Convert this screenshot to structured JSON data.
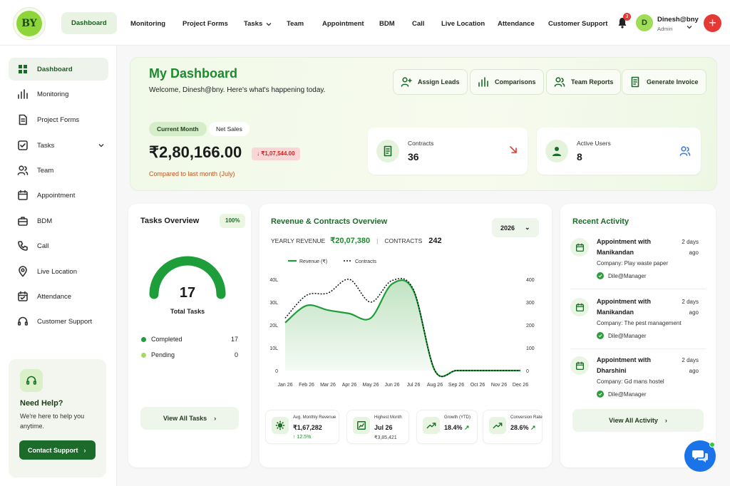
{
  "brand": {
    "logo_text": "BY"
  },
  "topnav": {
    "items": [
      {
        "label": "Dashboard"
      },
      {
        "label": "Monitoring"
      },
      {
        "label": "Project Forms"
      },
      {
        "label": "Tasks"
      },
      {
        "label": "Team"
      },
      {
        "label": "Appointment"
      },
      {
        "label": "BDM"
      },
      {
        "label": "Call"
      },
      {
        "label": "Live Location"
      },
      {
        "label": "Attendance"
      },
      {
        "label": "Customer Support"
      }
    ],
    "notification_count": "3",
    "user": {
      "initial": "D",
      "name": "Dinesh@bny",
      "role": "Admin"
    },
    "add_label": "+"
  },
  "sidebar": {
    "items": [
      {
        "label": "Dashboard",
        "icon": "grid-icon"
      },
      {
        "label": "Monitoring",
        "icon": "bar-chart-icon"
      },
      {
        "label": "Project Forms",
        "icon": "document-icon"
      },
      {
        "label": "Tasks",
        "icon": "checkbox-icon"
      },
      {
        "label": "Team",
        "icon": "users-icon"
      },
      {
        "label": "Appointment",
        "icon": "calendar-icon"
      },
      {
        "label": "BDM",
        "icon": "briefcase-icon"
      },
      {
        "label": "Call",
        "icon": "phone-icon"
      },
      {
        "label": "Live Location",
        "icon": "location-pin-icon"
      },
      {
        "label": "Attendance",
        "icon": "calendar-check-icon"
      },
      {
        "label": "Customer Support",
        "icon": "headset-icon"
      }
    ],
    "help": {
      "title": "Need Help?",
      "text": "We're here to help you anytime.",
      "button": "Contact Support"
    }
  },
  "hero": {
    "title": "My Dashboard",
    "subtitle": "Welcome, Dinesh@bny. Here's what's happening today.",
    "actions": [
      {
        "label": "Assign Leads",
        "icon": "user-plus-icon"
      },
      {
        "label": "Comparisons",
        "icon": "bar-chart-icon"
      },
      {
        "label": "Team Reports",
        "icon": "users-icon"
      },
      {
        "label": "Generate Invoice",
        "icon": "invoice-icon"
      }
    ],
    "tabs": [
      "Current Month",
      "Net Sales"
    ],
    "amount": "₹2,80,166.00",
    "delta": "↓ ₹1,07,544.00",
    "compare_text": "Compared to last month (July)",
    "kpis": [
      {
        "label": "Contracts",
        "value": "36",
        "trend": "down"
      },
      {
        "label": "Active Users",
        "value": "8"
      }
    ]
  },
  "tasks": {
    "title": "Tasks Overview",
    "percent": "100%",
    "progress": 1.0,
    "total": "17",
    "total_label": "Total Tasks",
    "legend": [
      {
        "label": "Completed",
        "value": "17",
        "color": "#1e9e3a"
      },
      {
        "label": "Pending",
        "value": "0",
        "color": "#a5d95f"
      }
    ],
    "button": "View All Tasks"
  },
  "revenue": {
    "title": "Revenue & Contracts Overview",
    "year": "2026",
    "yearly_label": "YEARLY REVENUE",
    "yearly_value": "₹20,07,380",
    "contracts_label": "CONTRACTS",
    "contracts_value": "242",
    "stats": [
      {
        "label": "Avg. Monthly Revenue",
        "value": "₹1,67,282",
        "sub": "↑ 12.5%",
        "icon": "gear-icon"
      },
      {
        "label": "Highest Month",
        "value": "Jul 26",
        "sub": "₹3,85,421",
        "icon": "chart-box-icon"
      },
      {
        "label": "Growth (YTD)",
        "value": "18.4%",
        "sub": "",
        "icon": "trend-up-icon"
      },
      {
        "label": "Conversion Rate",
        "value": "28.6%",
        "sub": "",
        "icon": "trend-up-icon"
      }
    ]
  },
  "chart_data": {
    "type": "line",
    "categories": [
      "Jan 26",
      "Feb 26",
      "Mar 26",
      "Apr 26",
      "May 26",
      "Jun 26",
      "Jul 26",
      "Aug 26",
      "Sep 26",
      "Oct 26",
      "Nov 26",
      "Dec 26"
    ],
    "series": [
      {
        "name": "Revenue (₹)",
        "axis": "left",
        "style": "area",
        "color": "#1e9e3a",
        "values": [
          21000,
          28500,
          26500,
          25000,
          23000,
          38000,
          35000,
          0,
          0,
          0,
          0,
          0
        ]
      },
      {
        "name": "Contracts",
        "axis": "right",
        "style": "dotted",
        "color": "#111111",
        "values": [
          230,
          330,
          340,
          400,
          300,
          395,
          355,
          0,
          0,
          0,
          0,
          0
        ]
      }
    ],
    "y_left": {
      "ticks": [
        "40L",
        "30L",
        "20L",
        "10L",
        "0"
      ],
      "lim": [
        0,
        40000
      ]
    },
    "y_right": {
      "ticks": [
        "400",
        "300",
        "200",
        "100",
        "0"
      ],
      "lim": [
        0,
        400
      ]
    },
    "legend_position": "top-left",
    "grid": false
  },
  "activity": {
    "title": "Recent Activity",
    "items": [
      {
        "title": "Appointment with Manikandan",
        "time": "2 days ago",
        "company": "Company: Play waste paper",
        "user": "Dile@Manager"
      },
      {
        "title": "Appointment with Manikandan",
        "time": "2 days ago",
        "company": "Company: The pest management",
        "user": "Dile@Manager"
      },
      {
        "title": "Appointment with Dharshini",
        "time": "2 days ago",
        "company": "Company: Gd mans hostel",
        "user": "Dile@Manager"
      }
    ],
    "button": "View All Activity"
  }
}
